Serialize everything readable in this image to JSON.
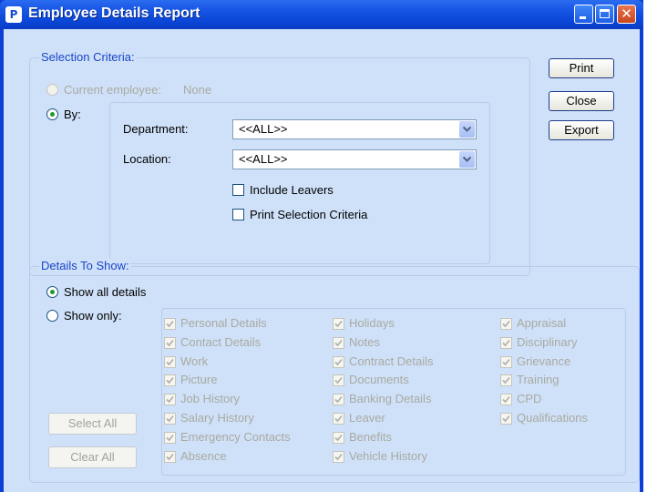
{
  "window": {
    "title": "Employee Details Report",
    "icon": "app-logo-icon"
  },
  "selection_criteria": {
    "title": "Selection Criteria:",
    "current_employee_label": "Current employee:",
    "current_employee_value": "None",
    "by_label": "By:",
    "department_label": "Department:",
    "department_value": "<<ALL>>",
    "location_label": "Location:",
    "location_value": "<<ALL>>",
    "include_leavers_label": "Include Leavers",
    "print_selection_label": "Print Selection Criteria"
  },
  "buttons": {
    "print": "Print",
    "close": "Close",
    "export": "Export"
  },
  "details": {
    "title": "Details To Show:",
    "show_all_label": "Show all details",
    "show_only_label": "Show only:",
    "select_all": "Select All",
    "clear_all": "Clear All",
    "col1": [
      "Personal Details",
      "Contact Details",
      "Work",
      "Picture",
      "Job History",
      "Salary History",
      "Emergency Contacts",
      "Absence"
    ],
    "col2": [
      "Holidays",
      "Notes",
      "Contract Details",
      "Documents",
      "Banking Details",
      "Leaver",
      "Benefits",
      "Vehicle History"
    ],
    "col3": [
      "Appraisal",
      "Disciplinary",
      "Grievance",
      "Training",
      "CPD",
      "Qualifications"
    ]
  },
  "colors": {
    "title_bar": "#0b47d8",
    "client_bg": "#cfe1f9",
    "group_title": "#1b45c8",
    "disabled_text": "#a9a9a0",
    "radio_dot": "#1f9b2e"
  }
}
